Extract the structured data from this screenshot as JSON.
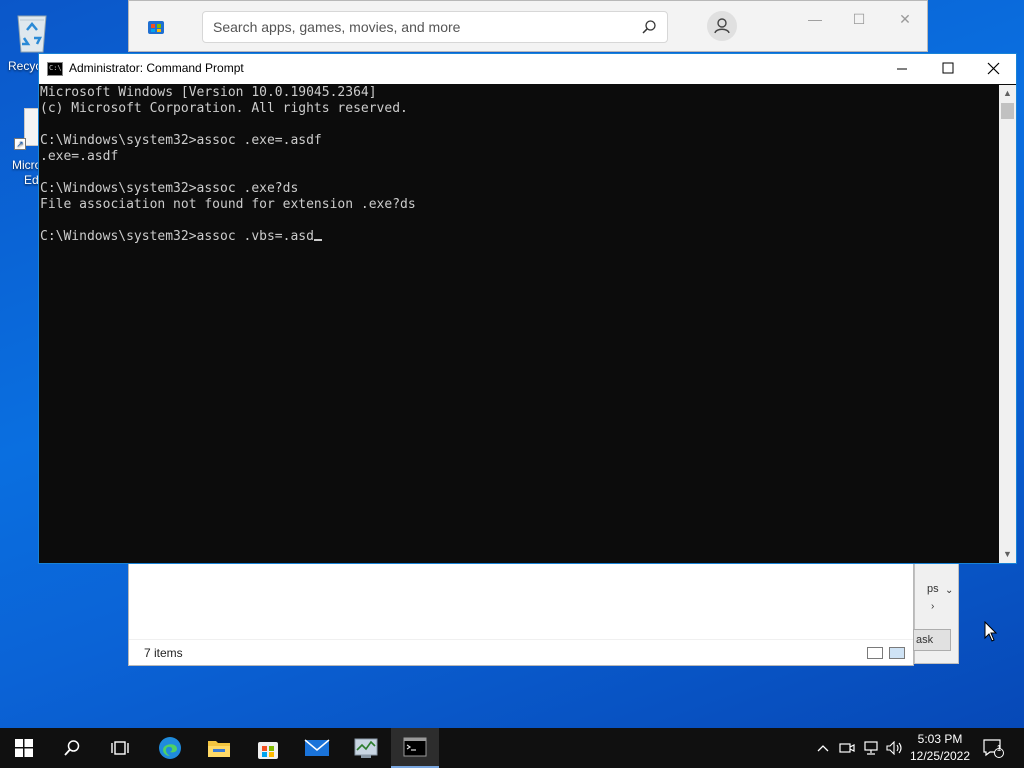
{
  "desktop": {
    "recycle_label": "Recyc",
    "edge_label_1": "Micro",
    "edge_label_2": "Ed"
  },
  "store": {
    "search_placeholder": "Search apps, games, movies, and more"
  },
  "explorer": {
    "status": "7 items"
  },
  "taskmgr": {
    "text": "ps",
    "button": "ask"
  },
  "cmd": {
    "title": "Administrator: Command Prompt",
    "lines": [
      "Microsoft Windows [Version 10.0.19045.2364]",
      "(c) Microsoft Corporation. All rights reserved.",
      "",
      "C:\\Windows\\system32>assoc .exe=.asdf",
      ".exe=.asdf",
      "",
      "C:\\Windows\\system32>assoc .exe?ds",
      "File association not found for extension .exe?ds",
      "",
      "C:\\Windows\\system32>assoc .vbs=.asd"
    ]
  },
  "taskbar": {
    "time": "5:03 PM",
    "date": "12/25/2022",
    "notification_count": "1"
  },
  "colors": {
    "accent": "#0078d7",
    "console_bg": "#0c0c0c",
    "console_fg": "#cccccc"
  }
}
